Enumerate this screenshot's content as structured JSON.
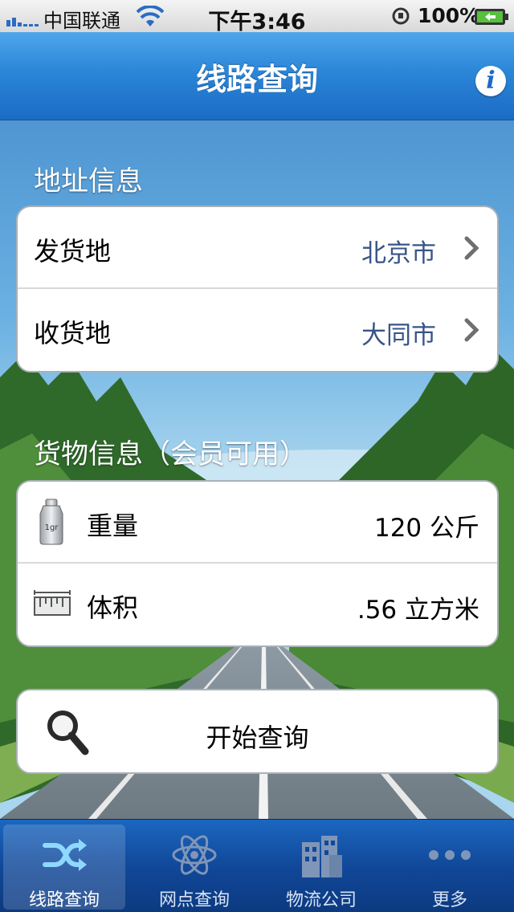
{
  "status_bar": {
    "carrier": "中国联通",
    "time": "下午3:46",
    "battery": "100%"
  },
  "nav": {
    "title": "线路查询",
    "info_label": "i"
  },
  "address_section": {
    "header": "地址信息",
    "rows": [
      {
        "label": "发货地",
        "value": "北京市"
      },
      {
        "label": "收货地",
        "value": "大同市"
      }
    ]
  },
  "cargo_section": {
    "header": "货物信息（会员可用）",
    "rows": [
      {
        "label": "重量",
        "value": "120 公斤",
        "icon": "weight-icon",
        "icon_text": "1gr"
      },
      {
        "label": "体积",
        "value": ".56 立方米",
        "icon": "ruler-icon"
      }
    ]
  },
  "query_button": {
    "label": "开始查询",
    "icon": "search-icon"
  },
  "tabs": [
    {
      "label": "线路查询",
      "icon": "shuffle-icon",
      "active": true
    },
    {
      "label": "网点查询",
      "icon": "atom-icon",
      "active": false
    },
    {
      "label": "物流公司",
      "icon": "building-icon",
      "active": false
    },
    {
      "label": "更多",
      "icon": "more-icon",
      "active": false
    }
  ],
  "colors": {
    "nav_blue": "#2b86d8",
    "tab_blue": "#11489a",
    "value_blue": "#385487"
  }
}
